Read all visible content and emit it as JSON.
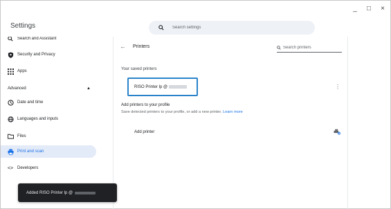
{
  "window": {
    "title": "Settings",
    "controls": [
      "_",
      "□",
      "×"
    ]
  },
  "search": {
    "placeholder": "Search settings",
    "icon": "search-icon"
  },
  "sidebar": {
    "items": [
      {
        "label": "Search and Assistant",
        "icon": "search-icon"
      },
      {
        "label": "Security and Privacy",
        "icon": "shield-icon"
      },
      {
        "label": "Apps",
        "icon": "apps-grid-icon"
      },
      {
        "label": "Date and time",
        "icon": "clock-icon"
      },
      {
        "label": "Languages and inputs",
        "icon": "globe-icon"
      },
      {
        "label": "Files",
        "icon": "folder-icon"
      },
      {
        "label": "Print and scan",
        "icon": "printer-icon",
        "selected": true
      },
      {
        "label": "Developers",
        "icon": "code-icon"
      }
    ],
    "advanced_label": "Advanced"
  },
  "main": {
    "heading": "Printers",
    "printer_search_placeholder": "Search printers",
    "saved_printers_label": "Your saved printers",
    "saved_printer_name": "RISO Printer lp @",
    "add_section_heading": "Add printers to your profile",
    "add_section_description": "Save detected printers to your profile, or add a new printer.",
    "learn_more": "Learn more",
    "add_printer_label": "Add printer"
  },
  "toast": {
    "message": "Added RISO Printer lp @"
  },
  "colors": {
    "accent": "#1a73e8",
    "selected_bg": "#e3eaf8",
    "highlight": "#2a83c9",
    "toast_bg": "#202124"
  }
}
